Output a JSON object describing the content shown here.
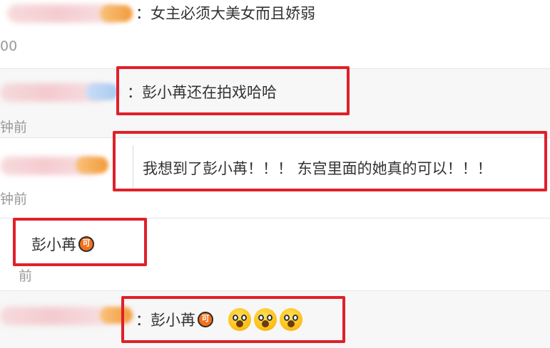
{
  "comments": [
    {
      "text": "：女主必须大美女而且娇弱",
      "meta": "00"
    },
    {
      "text": "：彭小苒还在拍戏哈哈",
      "meta": "钟前"
    },
    {
      "text": "我想到了彭小苒！！！ 东宫里面的她真的可以！！！",
      "meta": "钟前"
    },
    {
      "text": "彭小苒",
      "badge": "可",
      "meta": "前"
    },
    {
      "text": "：彭小苒",
      "badge": "可"
    }
  ],
  "emoji": {
    "name": "screaming-face-emoji",
    "count": 3
  },
  "colors": {
    "highlight_box": "#e0202a",
    "badge": "#f2711c",
    "meta_text": "#999999"
  }
}
